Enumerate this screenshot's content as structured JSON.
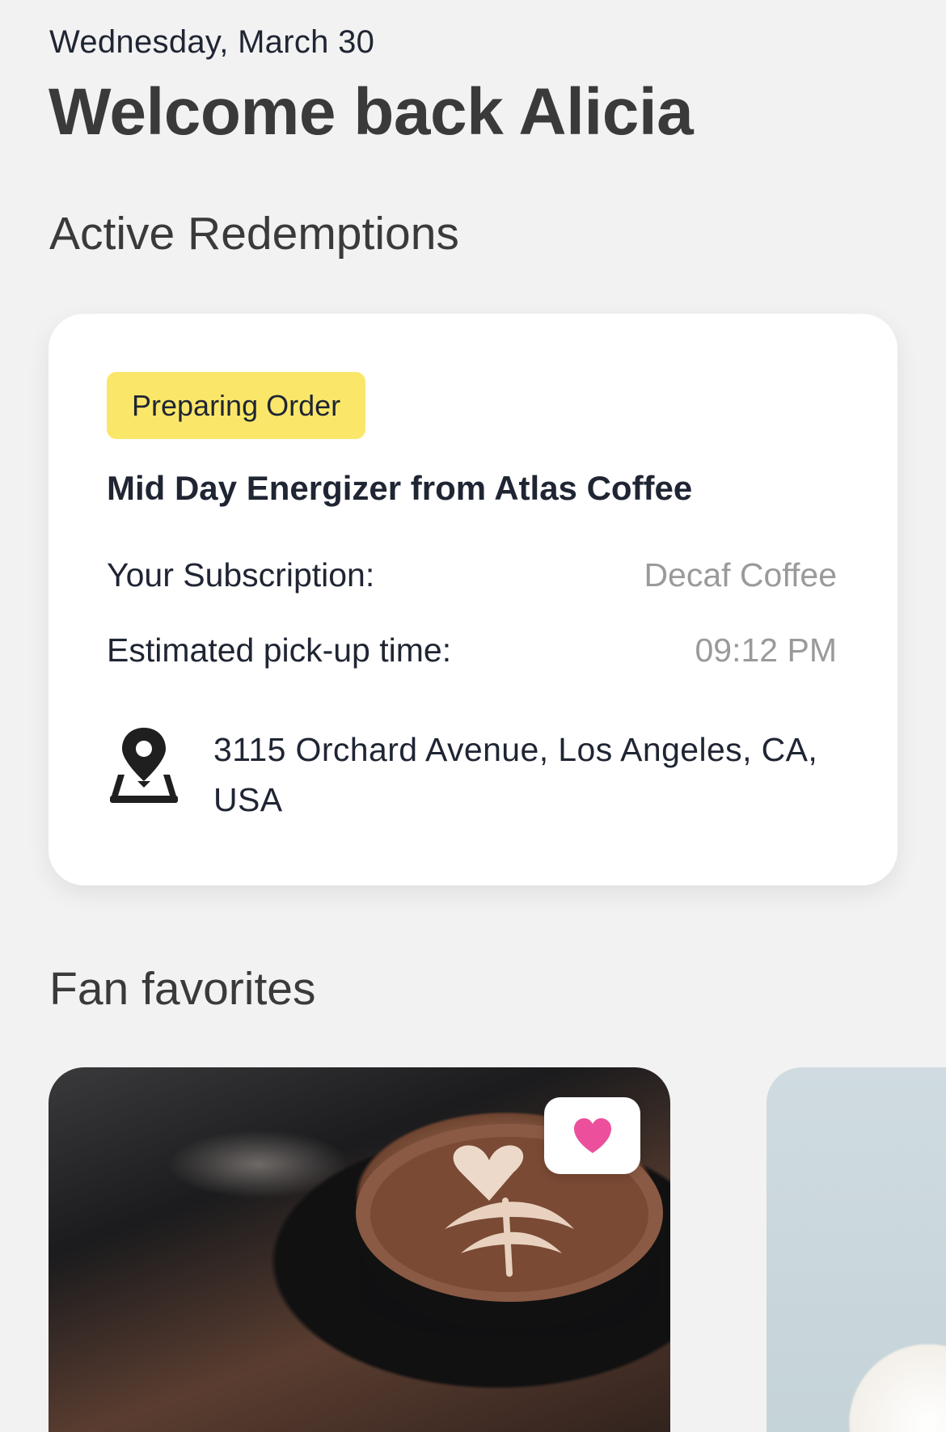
{
  "header": {
    "date": "Wednesday, March 30",
    "title": "Welcome back Alicia"
  },
  "active_redemptions": {
    "section_title": "Active Redemptions",
    "card": {
      "status_badge": "Preparing Order",
      "order_title": "Mid Day Energizer from Atlas Coffee",
      "subscription_label": "Your Subscription:",
      "subscription_value": "Decaf Coffee",
      "pickup_label": "Estimated pick-up time:",
      "pickup_value": "09:12 PM",
      "address_icon": "map-pin-icon",
      "address": "3115 Orchard Avenue, Los Angeles, CA, USA"
    }
  },
  "fan_favorites": {
    "section_title": "Fan favorites",
    "items": [
      {
        "image": "coffee-latte-photo",
        "favorite_icon": "heart-icon"
      },
      {
        "image": "food-bowl-photo"
      }
    ]
  },
  "colors": {
    "background": "#f2f2f2",
    "card": "#ffffff",
    "badge": "#fae769",
    "heart": "#ec4f9b",
    "muted_text": "#9a9a9a",
    "primary_text": "#1f2533"
  }
}
